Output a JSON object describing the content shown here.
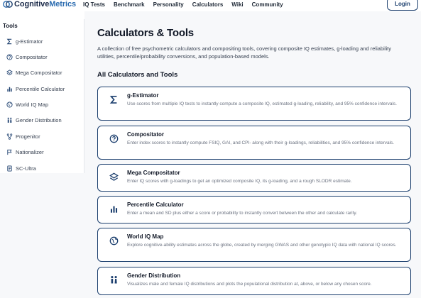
{
  "header": {
    "logo_text_main": "Cognitive",
    "logo_text_accent": "Metrics",
    "nav": [
      "IQ Tests",
      "Benchmark",
      "Personality",
      "Calculators",
      "Wiki",
      "Community"
    ],
    "login_label": "Login"
  },
  "sidebar": {
    "title": "Tools",
    "items": [
      {
        "label": "g-Estimator",
        "icon": "sigma-icon"
      },
      {
        "label": "Compositator",
        "icon": "question-circle-icon"
      },
      {
        "label": "Mega Compositator",
        "icon": "layers-icon"
      },
      {
        "label": "Percentile Calculator",
        "icon": "bar-chart-icon"
      },
      {
        "label": "World IQ Map",
        "icon": "globe-icon"
      },
      {
        "label": "Gender Distribution",
        "icon": "people-icon"
      },
      {
        "label": "Progenitor",
        "icon": "branch-icon"
      },
      {
        "label": "Nationalizer",
        "icon": "flag-icon"
      },
      {
        "label": "SC-Ultra",
        "icon": "document-icon"
      }
    ]
  },
  "main": {
    "title": "Calculators & Tools",
    "intro": "A collection of free psychometric calculators and compositing tools, covering composite IQ estimates, g-loading and reliability utilities, percentile/probability conversions, and population-based models.",
    "section_title": "All Calculators and Tools",
    "cards": [
      {
        "title": "g-Estimator",
        "desc": "Use scores from multiple IQ tests to instantly compute a composite IQ, estimated g-loading, reliability, and 95% confidence intervals.",
        "icon": "sigma-icon"
      },
      {
        "title": "Compositator",
        "desc": "Enter index scores to instantly compute FSIQ, GAI, and CPI- along with their g-loadings, reliabilities, and 95% confidence intervals.",
        "icon": "question-circle-icon"
      },
      {
        "title": "Mega Compositator",
        "desc": "Enter IQ scores with g-loadings to get an optimized composite IQ, its g-loading, and a rough SLODR estimate.",
        "icon": "layers-icon"
      },
      {
        "title": "Percentile Calculator",
        "desc": "Enter a mean and SD plus either a score or probability to instantly convert between the other and calculate rarity.",
        "icon": "bar-chart-icon"
      },
      {
        "title": "World IQ Map",
        "desc": "Explore cognitive-ability estimates across the globe, created by merging GWAS and other genotypic IQ data with national IQ scores.",
        "icon": "globe-icon"
      },
      {
        "title": "Gender Distribution",
        "desc": "Visualizes male and female IQ distributions and plots the populational distribution at, above, or below any chosen score.",
        "icon": "people-icon"
      }
    ]
  },
  "colors": {
    "brand": "#1c3f6e",
    "accent": "#2b6cb0",
    "background": "#f7f8fa"
  }
}
